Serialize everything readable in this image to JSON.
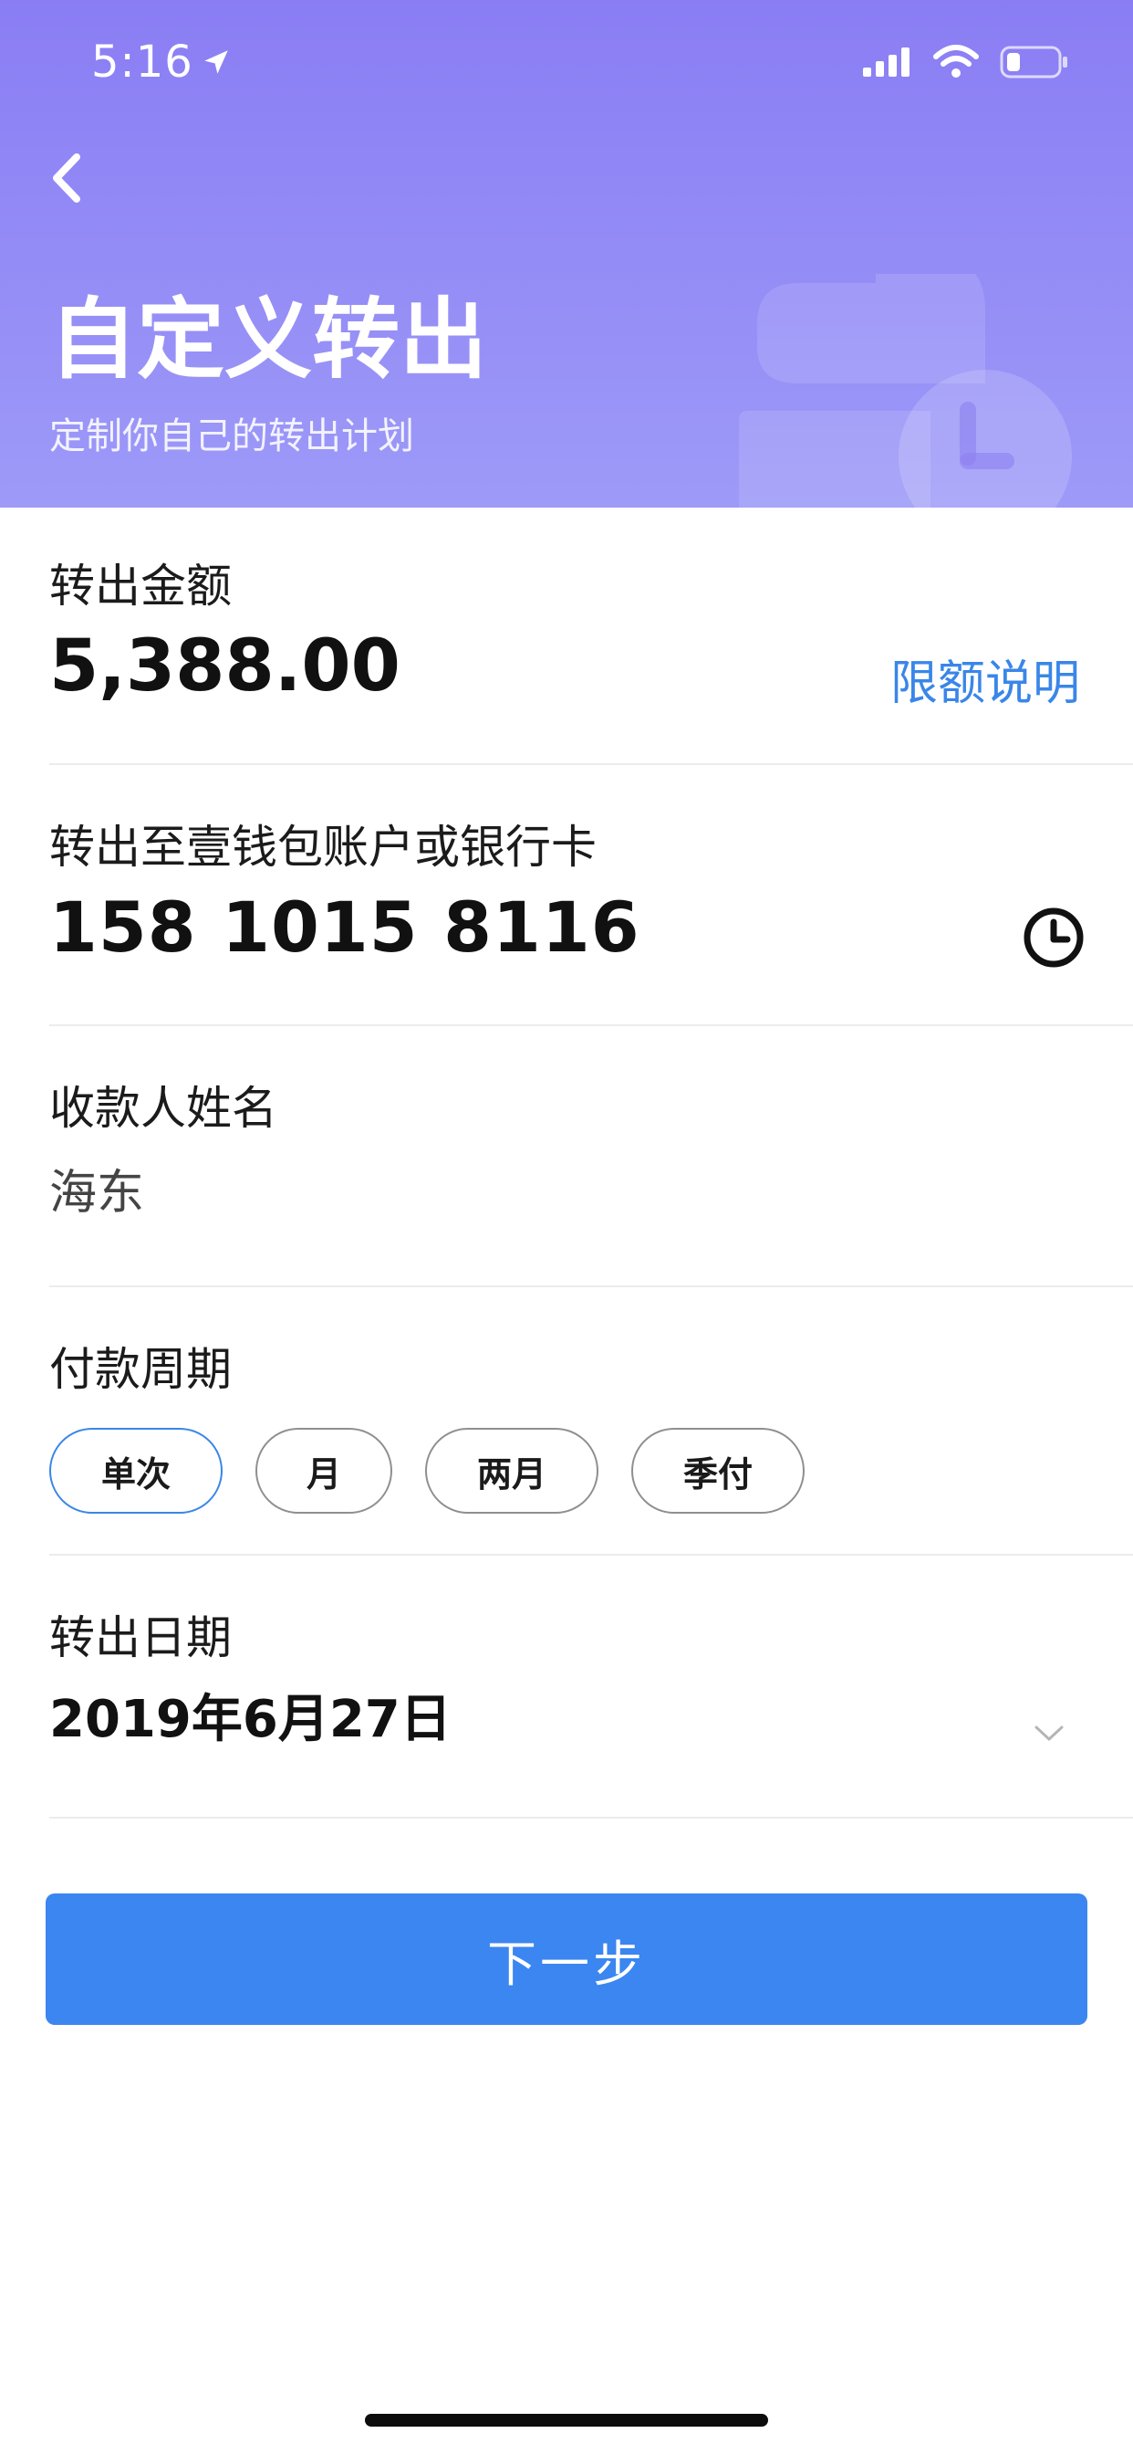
{
  "status_bar": {
    "time": "5:16",
    "icons": [
      "location-arrow-icon",
      "signal-icon",
      "wifi-icon",
      "battery-icon"
    ]
  },
  "header": {
    "title": "自定义转出",
    "subtitle": "定制你自己的转出计划",
    "back_icon": "chevron-left-icon",
    "colors": {
      "gradient_top": "#8a7df4",
      "gradient_bottom": "#9d9af8"
    }
  },
  "amount": {
    "label": "转出金额",
    "value": "5,388.00",
    "link": "限额说明"
  },
  "destination": {
    "label": "转出至壹钱包账户或银行卡",
    "value": "158 1015 8116",
    "icon": "clock-icon"
  },
  "payee": {
    "label": "收款人姓名",
    "value": "海东"
  },
  "period": {
    "label": "付款周期",
    "options": [
      "单次",
      "月",
      "两月",
      "季付"
    ],
    "selected": "单次"
  },
  "date": {
    "label": "转出日期",
    "value": "2019年6月27日",
    "icon": "chevron-down-icon"
  },
  "next_button": "下一步",
  "colors": {
    "accent": "#3b86f0",
    "link": "#3a86e8"
  }
}
